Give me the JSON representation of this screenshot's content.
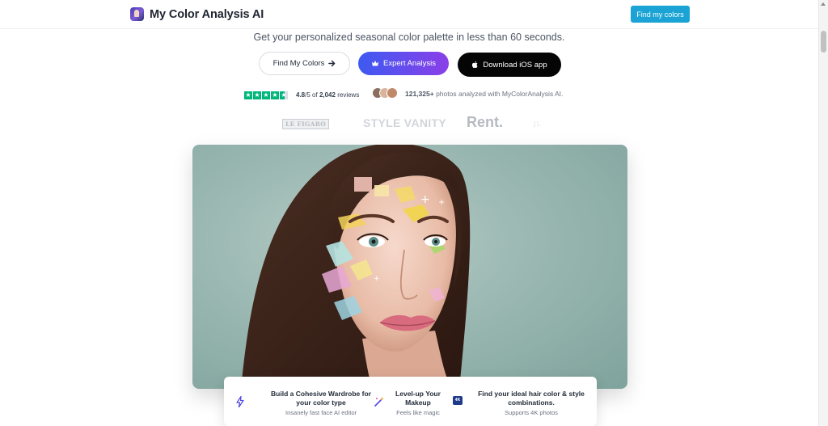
{
  "header": {
    "brand_name": "My Color Analysis AI",
    "cta_label": "Find my colors"
  },
  "hero": {
    "subtitle": "Get your personalized seasonal color palette in less than 60 seconds.",
    "buttons": {
      "find": "Find My Colors",
      "expert": "Expert Analysis",
      "ios": "Download iOS app"
    }
  },
  "rating": {
    "score": "4.8",
    "of": "/5 of",
    "count": "2,042",
    "reviews": "reviews"
  },
  "photos": {
    "count": "121,325+",
    "text": "photos analyzed with MyColorAnalysis AI."
  },
  "press": [
    "LE FIGARO",
    "STYLE VANITY",
    "Rent.",
    "JL"
  ],
  "features": [
    {
      "title_line1": "Build a Cohesive Wardrobe for",
      "title_line2": "your color type",
      "sub": "Insanely fast face AI editor",
      "icon": "lightning-icon"
    },
    {
      "title_line1": "Level-up Your",
      "title_line2": "Makeup",
      "sub": "Feels like magic",
      "icon": "magic-wand-icon"
    },
    {
      "title_line1": "Find your ideal hair color & style",
      "title_line2": "combinations.",
      "sub": "Supports 4K photos",
      "icon": "4k-badge-icon"
    }
  ],
  "badge_4k": "4K",
  "colors": {
    "accent": "#1aa3d4",
    "trustpilot": "#00b67a",
    "gradient_start": "#3d5af1",
    "gradient_end": "#8b3fe8"
  }
}
